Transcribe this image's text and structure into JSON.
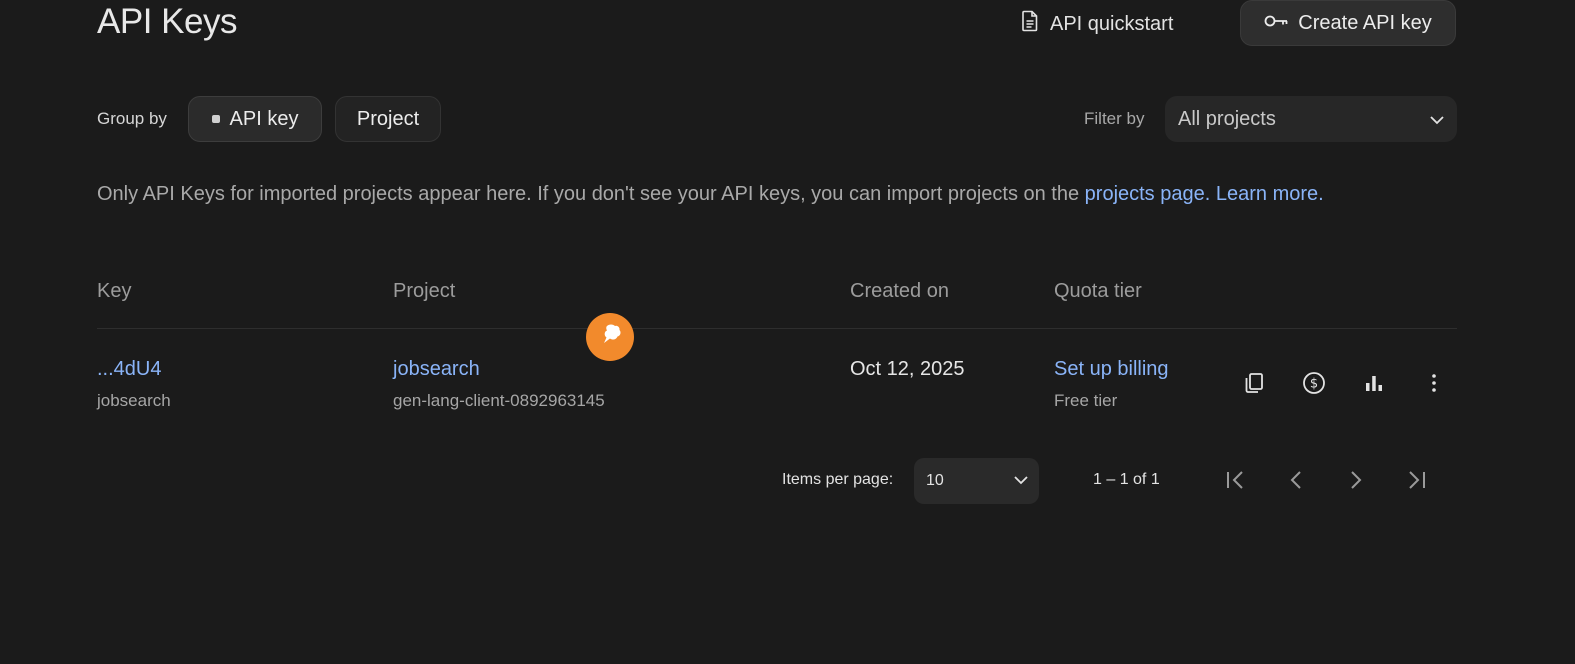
{
  "header": {
    "title": "API Keys",
    "quickstart_label": "API quickstart",
    "create_label": "Create API key"
  },
  "group_by": {
    "label": "Group by",
    "options": [
      "API key",
      "Project"
    ],
    "selected": "API key"
  },
  "filter": {
    "label": "Filter by",
    "value": "All projects"
  },
  "info": {
    "text": "Only API Keys for imported projects appear here. If you don't see your API keys, you can import projects on the ",
    "link1": "projects page.",
    "link2": "Learn more."
  },
  "table": {
    "columns": [
      "Key",
      "Project",
      "Created on",
      "Quota tier"
    ],
    "rows": [
      {
        "key": "...4dU4",
        "key_name": "jobsearch",
        "project": "jobsearch",
        "project_id": "gen-lang-client-0892963145",
        "created": "Oct 12, 2025",
        "quota_link": "Set up billing",
        "quota_tier": "Free tier",
        "actions": [
          "copy-icon",
          "billing-icon",
          "usage-chart-icon",
          "more-vert-icon"
        ]
      }
    ]
  },
  "pagination": {
    "items_per_page_label": "Items per page:",
    "items_per_page": "10",
    "range": "1 – 1 of 1"
  },
  "colors": {
    "background": "#1b1b1b",
    "link": "#8ab4f8",
    "fab": "#f28a2c"
  }
}
